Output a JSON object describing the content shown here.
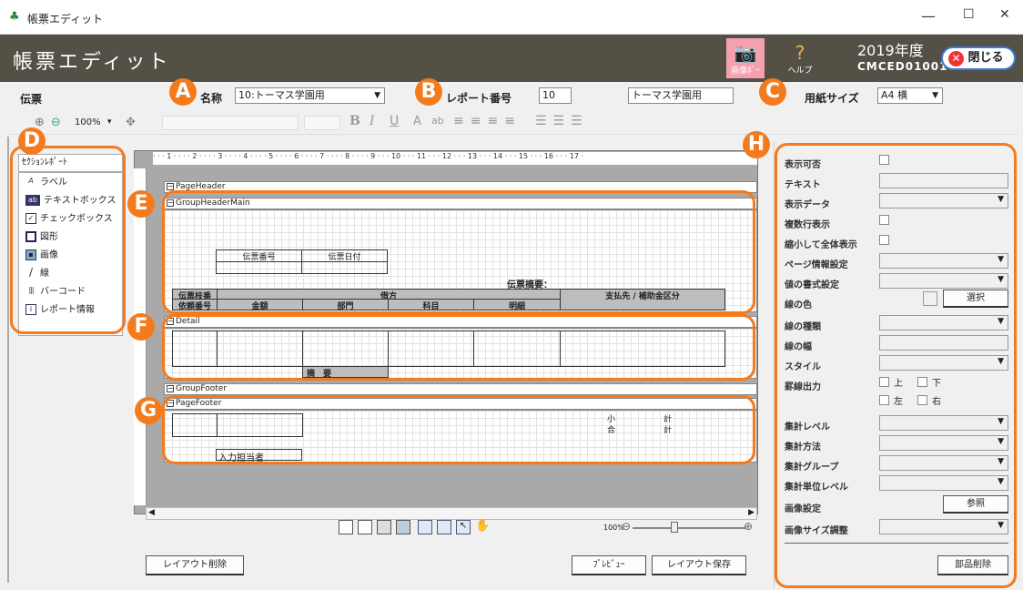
{
  "window": {
    "title": "帳票エディット",
    "minimize": "—",
    "maximize": "☐",
    "close": "✕"
  },
  "appbar": {
    "title": "帳票エディット",
    "btn_image_label": "画像ﾎﾞｰ",
    "btn_help_label": "ヘルプ",
    "year": "2019年度",
    "code": "CMCED01001",
    "close_label": "閉じる"
  },
  "badges": [
    "A",
    "B",
    "C",
    "D",
    "E",
    "F",
    "G",
    "H"
  ],
  "form": {
    "section_label": "伝票",
    "name_label": "名称",
    "name_value": "10:トーマス学園用",
    "report_no_label": "レポート番号",
    "report_no_value": "10",
    "report_name_value": "トーマス学園用",
    "paper_label": "用紙サイズ",
    "paper_value": "A4 横"
  },
  "toolbar": {
    "zoom": "100%"
  },
  "left_panel": {
    "header": "ｾｸｼｮﾝﾚﾎﾟｰﾄ",
    "tools": [
      {
        "icon": "A",
        "label": "ラベル"
      },
      {
        "icon": "ab",
        "label": "テキストボックス"
      },
      {
        "icon": "✓",
        "label": "チェックボックス"
      },
      {
        "icon": "",
        "label": "図形"
      },
      {
        "icon": "▪",
        "label": "画像"
      },
      {
        "icon": "/",
        "label": "線"
      },
      {
        "icon": "|||",
        "label": "バーコード"
      },
      {
        "icon": "i",
        "label": "レポート情報"
      }
    ]
  },
  "ruler": "· · · 1 · · · · 2 · · · · 3 · · · · 4 · · · · 5 · · · · 6 · · · · 7 · · · · 8 · · · · 9 · · · 10 · · · 11 · · · 12 · · · 13 · · · 14 · · · 15 · · · 16 · · · 17 ·",
  "bands": {
    "page_header": "PageHeader",
    "group_header": "GroupHeaderMain",
    "detail": "Detail",
    "group_footer": "GroupFooter",
    "page_footer": "PageFooter"
  },
  "report": {
    "slip_no": "伝票番号",
    "slip_date": "伝票日付",
    "summary": "伝票摘要：",
    "slip_row_no": "伝票枝番",
    "request_no": "依頼番号",
    "debit": "借方",
    "payee": "支払先 / 補助金区分",
    "amount": "金額",
    "dept": "部門",
    "account": "科目",
    "detail_col": "明細",
    "memo": "摘　要",
    "subtotal_a": "小",
    "subtotal_b": "計",
    "total_a": "合",
    "total_b": "計",
    "operator": "入力担当者"
  },
  "bottom": {
    "zoom_value": "100%",
    "delete_layout": "レイアウト削除",
    "preview": "ﾌﾟﾚﾋﾞｭｰ",
    "save_layout": "レイアウト保存"
  },
  "right_panel": {
    "visible": "表示可否",
    "text": "テキスト",
    "display_data": "表示データ",
    "multiline": "複数行表示",
    "shrink": "縮小して全体表示",
    "page_info": "ページ情報設定",
    "value_format": "値の書式設定",
    "line_color": "線の色",
    "select_btn": "選択",
    "line_type": "線の種類",
    "line_width": "線の幅",
    "style": "スタイル",
    "border_output": "罫線出力",
    "top": "上",
    "bottom": "下",
    "left": "左",
    "right": "右",
    "agg_level": "集計レベル",
    "agg_method": "集計方法",
    "agg_group": "集計グループ",
    "agg_unit_level": "集計単位レベル",
    "image_setting": "画像設定",
    "browse_btn": "参照",
    "image_size": "画像サイズ調整",
    "delete_part": "部品削除"
  }
}
